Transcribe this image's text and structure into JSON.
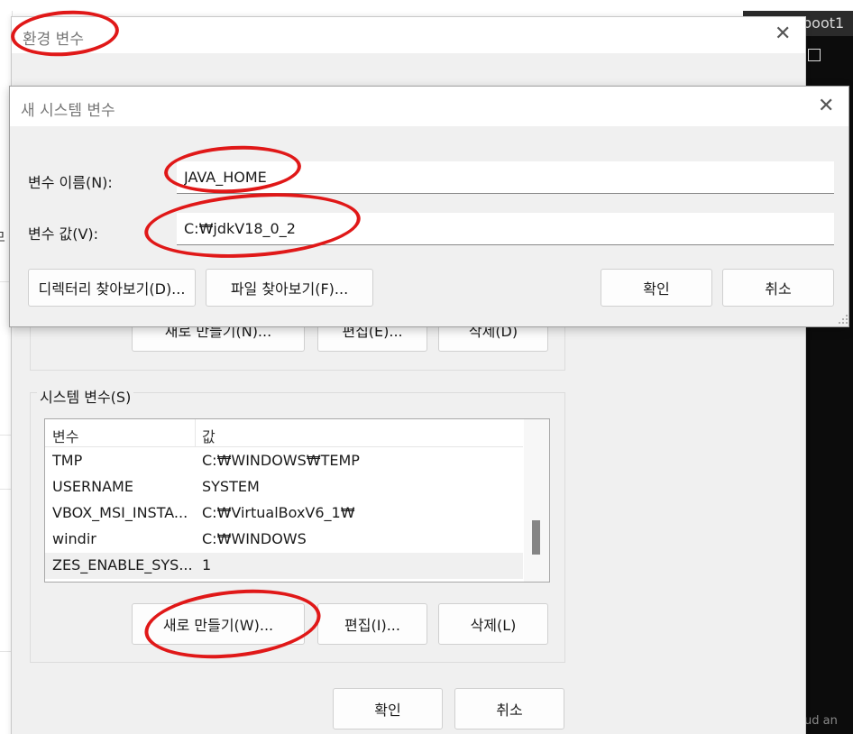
{
  "background": {
    "terminal_title": "boot1",
    "left_window_glyph": "므",
    "terminal_bottom_text": "ud an"
  },
  "env_window": {
    "title": "환경 변수",
    "user_vars_buttons": {
      "new": "새로 만들기(N)...",
      "edit": "편집(E)...",
      "delete": "삭제(D)"
    },
    "system_vars": {
      "label": "시스템 변수(S)",
      "columns": [
        "변수",
        "값"
      ],
      "rows": [
        {
          "name": "TMP",
          "value": "C:₩WINDOWS₩TEMP"
        },
        {
          "name": "USERNAME",
          "value": "SYSTEM"
        },
        {
          "name": "VBOX_MSI_INSTA...",
          "value": "C:₩VirtualBoxV6_1₩"
        },
        {
          "name": "windir",
          "value": "C:₩WINDOWS"
        },
        {
          "name": "ZES_ENABLE_SYS...",
          "value": "1"
        }
      ],
      "selected_row_index": 4,
      "buttons": {
        "new": "새로 만들기(W)...",
        "edit": "편집(I)...",
        "delete": "삭제(L)"
      }
    },
    "ok": "확인",
    "cancel": "취소"
  },
  "new_var_dialog": {
    "title": "새 시스템 변수",
    "name_label": "변수 이름(N):",
    "name_value": "JAVA_HOME",
    "value_label": "변수 값(V):",
    "value_value": "C:₩jdkV18_0_2",
    "browse_dir": "디렉터리 찾아보기(D)...",
    "browse_file": "파일 찾아보기(F)...",
    "ok": "확인",
    "cancel": "취소"
  },
  "annotations": {
    "color": "#e01818",
    "highlighted": [
      "window-title",
      "variable-name",
      "variable-value",
      "system-new-button"
    ]
  },
  "icons": {
    "close": "close-icon",
    "resize": "resize-grip-icon"
  }
}
